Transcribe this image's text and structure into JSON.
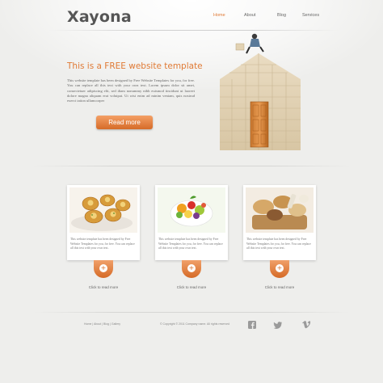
{
  "brand": {
    "logo": "Xayona",
    "accent": "#e07a35"
  },
  "nav": {
    "items": [
      {
        "label": "Home",
        "active": true
      },
      {
        "label": "About"
      },
      {
        "label": "Blog"
      },
      {
        "label": "Services"
      }
    ]
  },
  "hero": {
    "title": "This is a FREE website template",
    "body": "This website template has been designed by Free Website Templates for you, for free. You can replace all this text with your own text. Lorem ipsum dolor sit amet, consectetuer adipiscing elit, sed diam nonummy nibh euismod tincidunt ut laoreet dolore magna aliquam erat volutpat. Ut wisi enim ad minim veniam, quis nostrud exerci tation ullamcorper",
    "button": "Read more"
  },
  "cards": [
    {
      "image": "pastry-photo",
      "text": "This website template has been designed by Free Website Templates for you, for free. You can replace all this text with your own text.",
      "more": "Click to read more"
    },
    {
      "image": "fruit-salad-photo",
      "text": "This website template has been designed by Free Website Templates for you, for free. You can replace all this text with your own text.",
      "more": "Click to read more"
    },
    {
      "image": "bread-basket-photo",
      "text": "This website template has been designed by Free Website Templates for you, for free. You can replace all this text with your own text.",
      "more": "Click to read more"
    }
  ],
  "footer": {
    "links": "Home | About | Blog | Gallery",
    "copyright": "© Copyright © 2011 Company name. All rights reserved",
    "social": [
      "facebook-icon",
      "twitter-icon",
      "vimeo-icon"
    ]
  }
}
